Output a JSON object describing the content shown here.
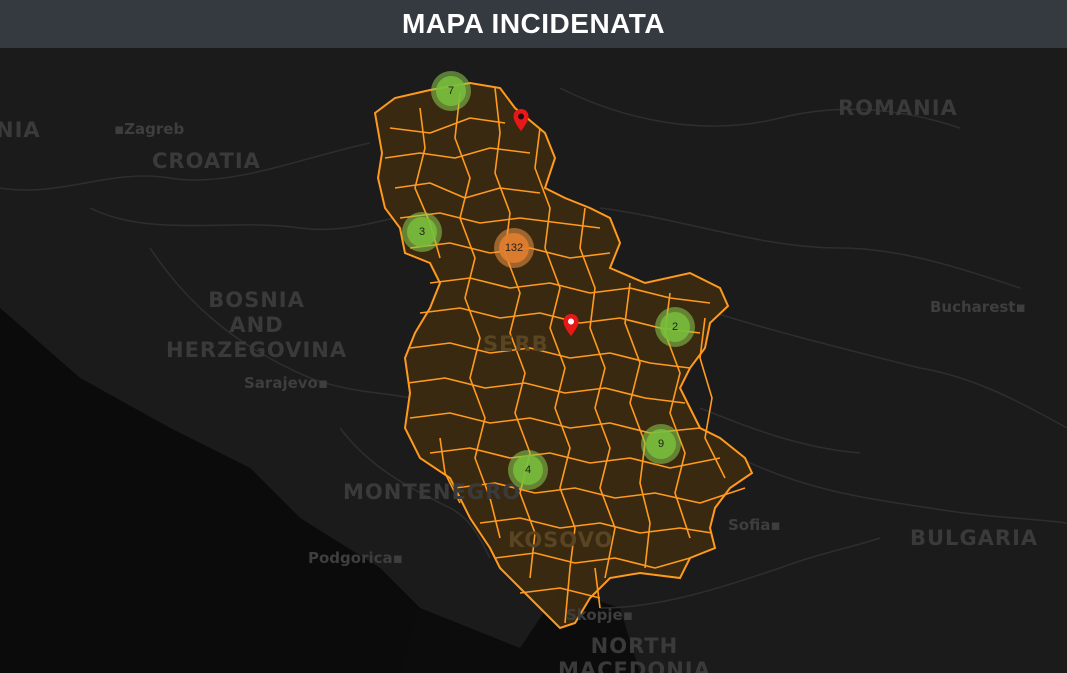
{
  "header": {
    "title": "MAPA INCIDENATA"
  },
  "colors": {
    "basemap_land": "#1b1b1b",
    "basemap_sea": "#0b0b0b",
    "region_fill": "#3b2a10",
    "region_border": "#ff9a1f",
    "cluster_small": "#8ccd50",
    "cluster_medium": "#f0964a",
    "marker": "#e81818"
  },
  "map": {
    "country_labels": {
      "croatia": "CROATIA",
      "romania": "ROMANIA",
      "bosnia": "BOSNIA\nAND\nHERZEGOVINA",
      "montenegro": "MONTENEGRO",
      "kosovo": "KOSOVO",
      "bulgaria": "BULGARIA",
      "north_macedonia": "NORTH\nMACEDONIA",
      "slovenia_partial": "NIA",
      "serbia_partial": "SERB"
    },
    "city_labels": {
      "zagreb": "Zagreb",
      "bucharest": "Bucharest",
      "sarajevo": "Sarajevo",
      "podgorica": "Podgorica",
      "sofia": "Sofia",
      "skopje": "Skopje"
    },
    "clusters": [
      {
        "id": "north",
        "count": "7",
        "size": "small"
      },
      {
        "id": "west",
        "count": "3",
        "size": "small"
      },
      {
        "id": "central",
        "count": "132",
        "size": "medium"
      },
      {
        "id": "east",
        "count": "2",
        "size": "small"
      },
      {
        "id": "southeast",
        "count": "9",
        "size": "small"
      },
      {
        "id": "southwest",
        "count": "4",
        "size": "small"
      }
    ],
    "markers": [
      {
        "id": "north-east",
        "icon": "map-pin-icon"
      },
      {
        "id": "central-east",
        "icon": "map-pin-icon"
      }
    ]
  }
}
